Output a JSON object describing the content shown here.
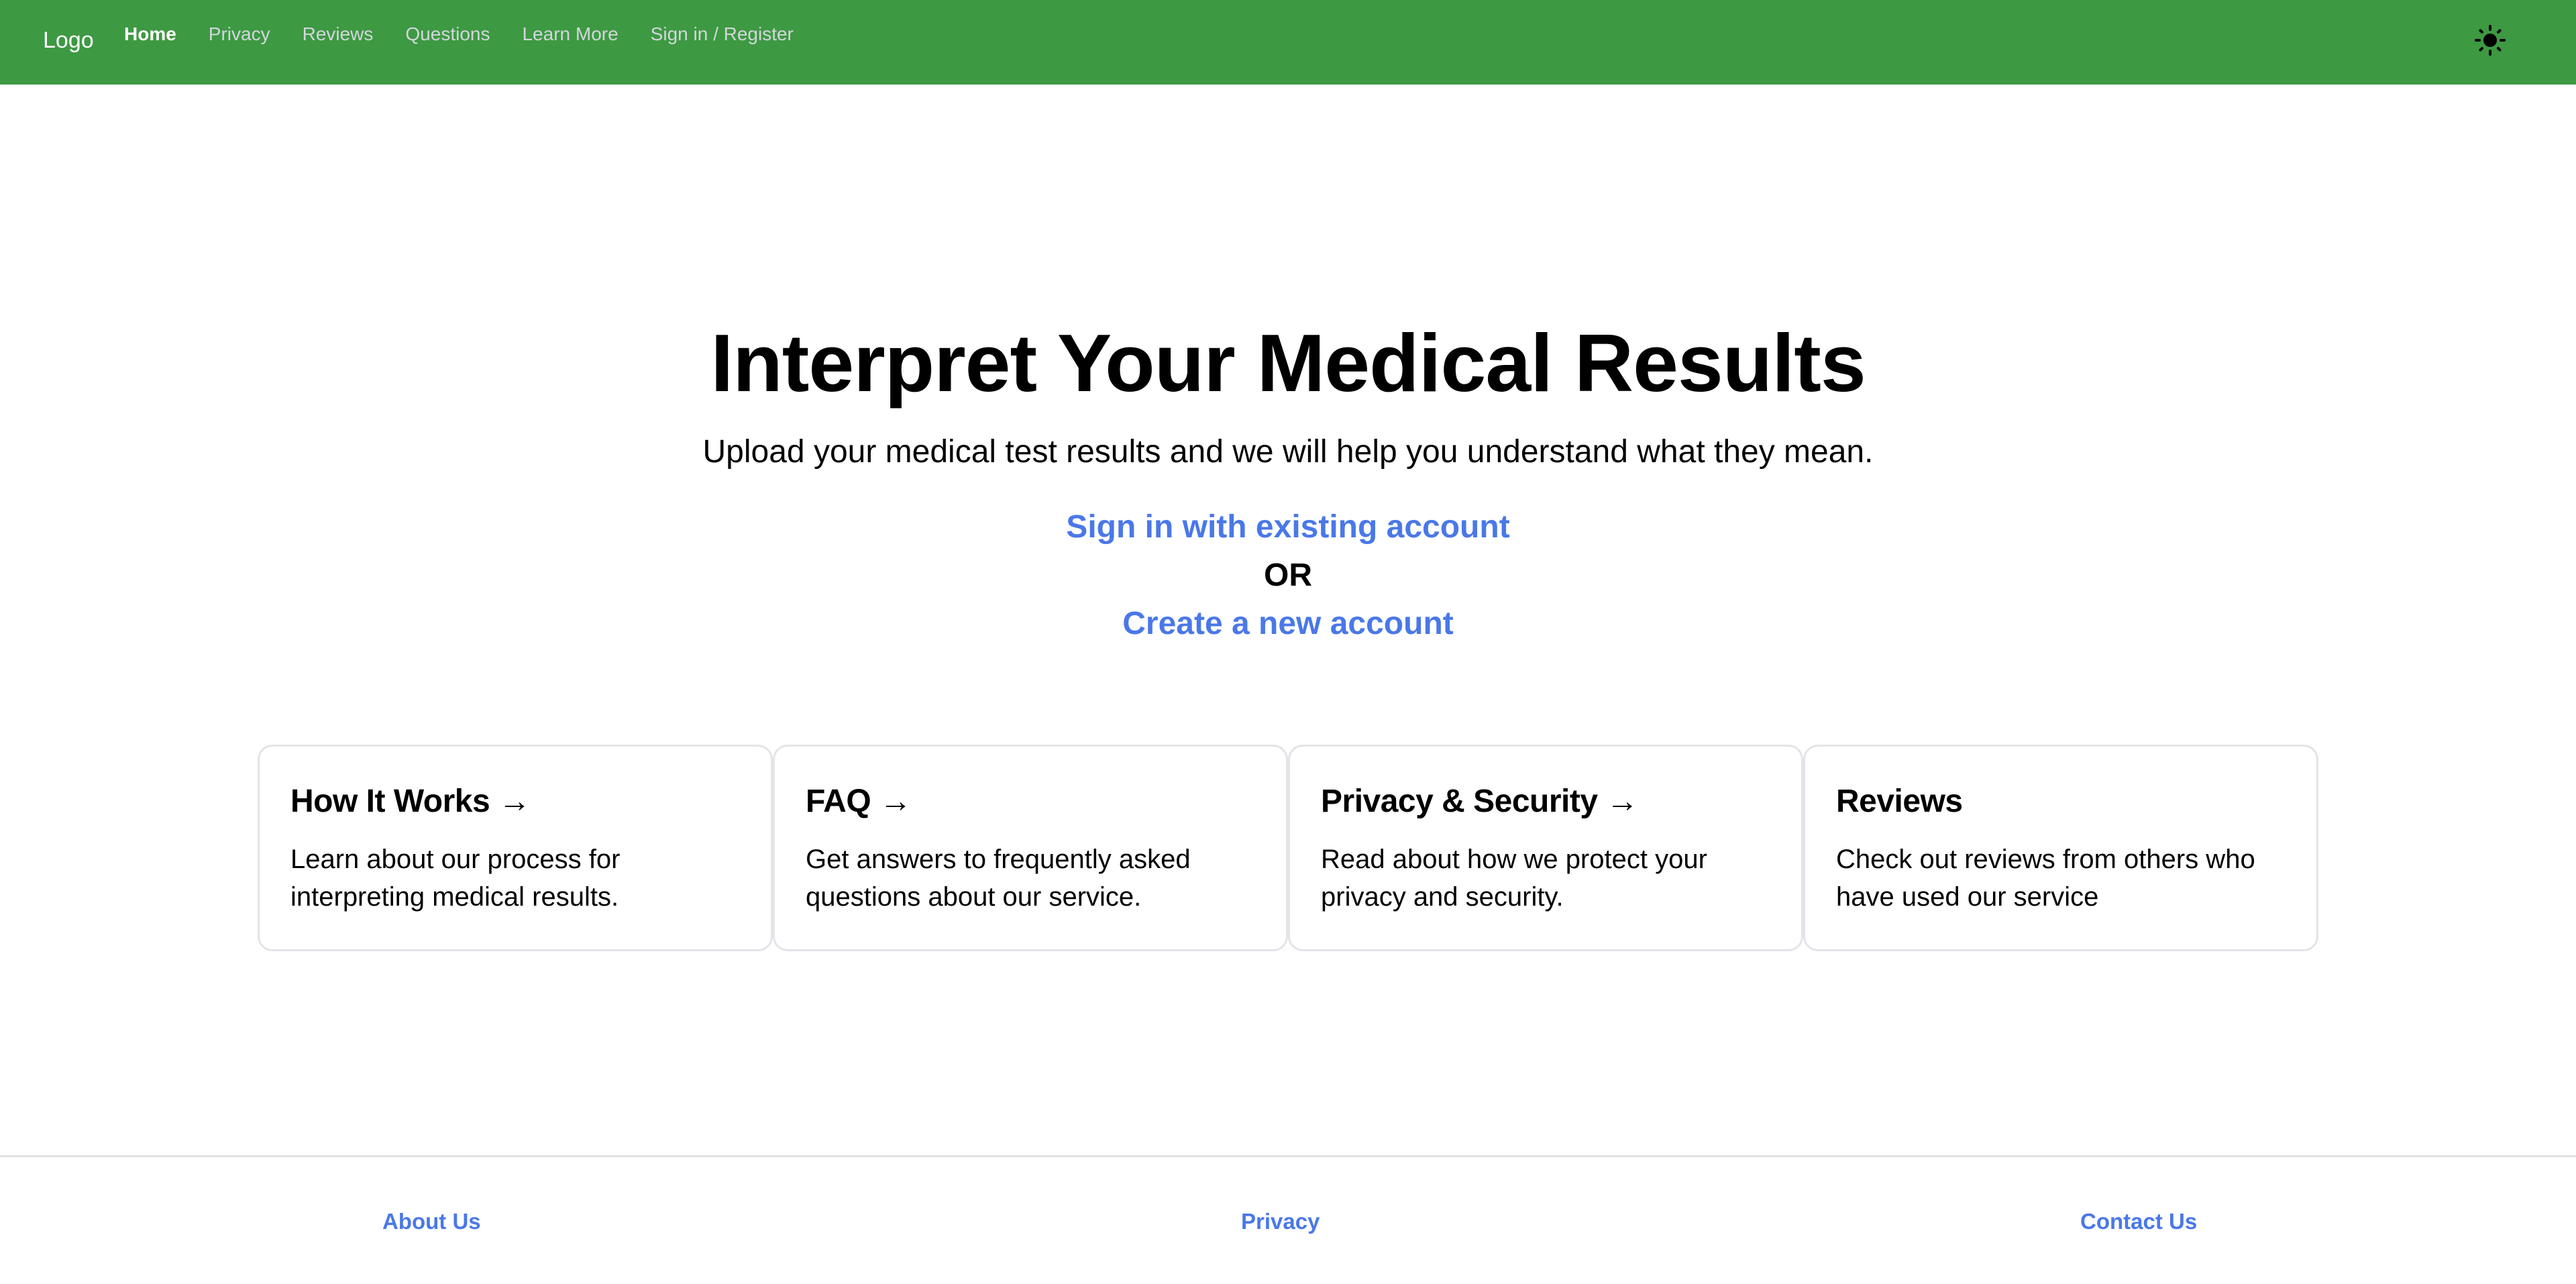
{
  "navbar": {
    "logo": "Logo",
    "links": [
      {
        "label": "Home",
        "active": true
      },
      {
        "label": "Privacy",
        "active": false
      },
      {
        "label": "Reviews",
        "active": false
      },
      {
        "label": "Questions",
        "active": false
      },
      {
        "label": "Learn More",
        "active": false
      },
      {
        "label": "Sign in / Register",
        "active": false
      }
    ],
    "theme_toggle_icon": "sun-icon",
    "background_color": "#3d9942"
  },
  "hero": {
    "title": "Interpret Your Medical Results",
    "subtitle": "Upload your medical test results and we will help you understand what they mean.",
    "signin_link": "Sign in with existing account",
    "or_label": "OR",
    "create_link": "Create a new account",
    "link_color": "#4a78e8"
  },
  "cards": [
    {
      "title": "How It Works →",
      "text": "Learn about our process for interpreting medical results."
    },
    {
      "title": "FAQ →",
      "text": "Get answers to frequently asked questions about our service."
    },
    {
      "title": "Privacy & Security →",
      "text": "Read about how we protect your privacy and security."
    },
    {
      "title": "Reviews",
      "text": "Check out reviews from others who have used our service"
    }
  ],
  "footer": {
    "about": "About Us",
    "privacy": "Privacy",
    "contact": "Contact Us"
  }
}
